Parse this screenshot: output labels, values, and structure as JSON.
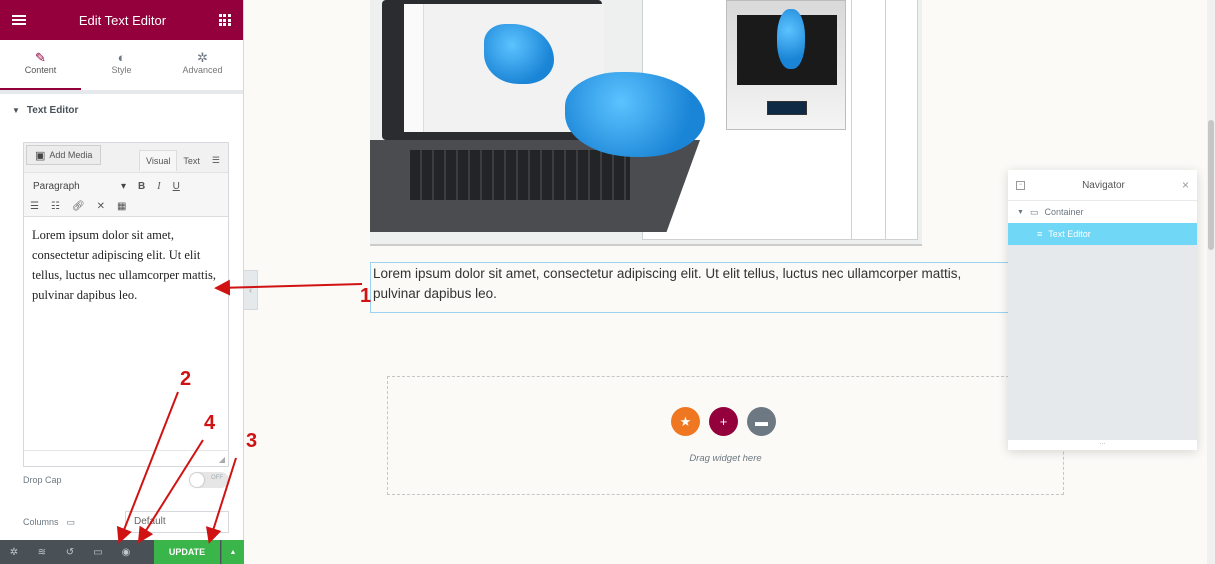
{
  "panel": {
    "title": "Edit Text Editor",
    "tabs": [
      {
        "label": "Content",
        "icon": "pencil-icon"
      },
      {
        "label": "Style",
        "icon": "half-circle-icon"
      },
      {
        "label": "Advanced",
        "icon": "gear-icon"
      }
    ],
    "section_title": "Text Editor",
    "add_media_label": "Add Media",
    "visual_tab": "Visual",
    "text_tab": "Text",
    "paragraph_select": "Paragraph",
    "editor_content": "Lorem ipsum dolor sit amet, consectetur adipiscing elit. Ut elit tellus, luctus nec ullamcorper mattis, pulvinar dapibus leo.",
    "drop_cap_label": "Drop Cap",
    "drop_cap_state": "OFF",
    "columns_label": "Columns",
    "columns_value": "Default",
    "update_label": "UPDATE"
  },
  "canvas": {
    "text": "Lorem ipsum dolor sit amet, consectetur adipiscing elit. Ut elit tellus, luctus nec ullamcorper mattis, pulvinar dapibus leo.",
    "drag_widget_text": "Drag widget here"
  },
  "navigator": {
    "title": "Navigator",
    "items": [
      {
        "label": "Container"
      },
      {
        "label": "Text Editor"
      }
    ]
  },
  "annotations": [
    "1",
    "2",
    "3",
    "4"
  ],
  "colors": {
    "brand": "#93003c",
    "update": "#39b54a",
    "nav_selected": "#71d7f7",
    "annotation": "#d01212",
    "add_section": "#93003c",
    "add_template": "#f07722",
    "add_folder": "#6d7882"
  }
}
